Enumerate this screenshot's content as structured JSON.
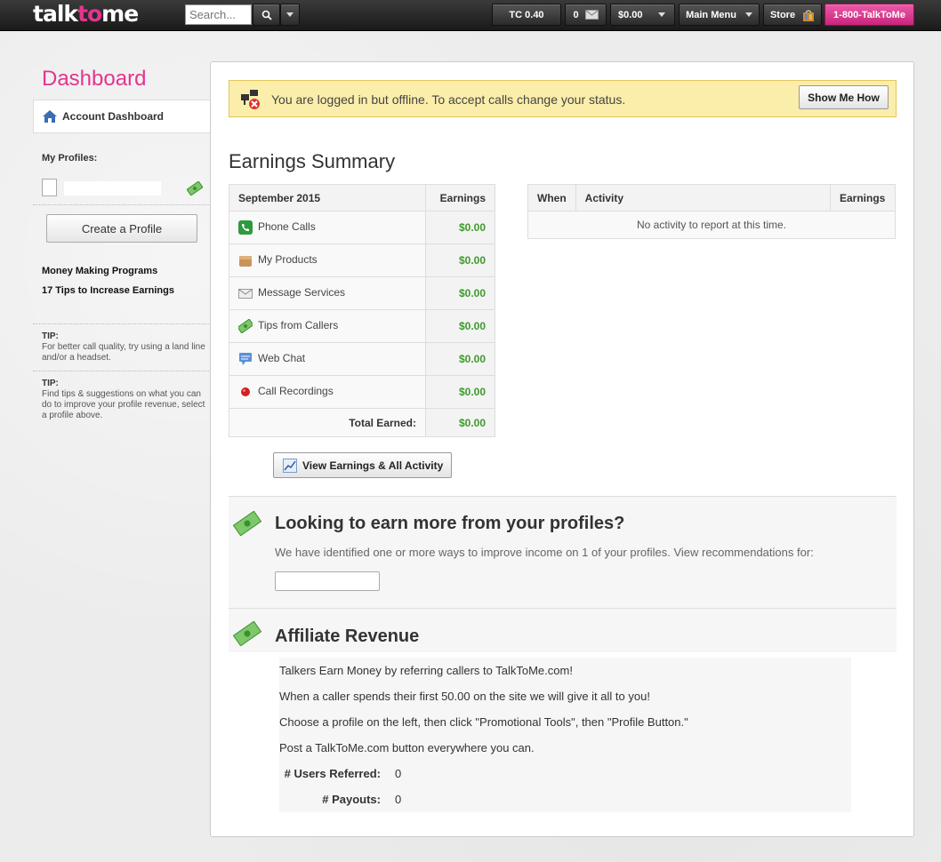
{
  "topbar": {
    "logo_a": "talk",
    "logo_b": "to",
    "logo_c": "me",
    "search_placeholder": "Search...",
    "tc_balance": "TC 0.40",
    "messages_count": "0",
    "balance": "$0.00",
    "main_menu": "Main Menu",
    "store": "Store",
    "phone": "1-800-TalkToMe"
  },
  "sidebar": {
    "title": "Dashboard",
    "account_tab": "Account Dashboard",
    "my_profiles": "My Profiles:",
    "create_profile": "Create a Profile",
    "links": [
      "Money Making Programs",
      "17 Tips to Increase Earnings"
    ],
    "tips": [
      {
        "label": "TIP:",
        "text": "For better call quality, try using a land line and/or a headset."
      },
      {
        "label": "TIP:",
        "text": "Find tips & suggestions on what you can do to improve your profile revenue, select a profile above."
      }
    ]
  },
  "alert": {
    "text": "You are logged in but offline. To accept calls change your status.",
    "button": "Show Me How"
  },
  "earnings": {
    "title": "Earnings Summary",
    "period": "September 2015",
    "col_earnings": "Earnings",
    "rows": [
      {
        "label": "Phone Calls",
        "amount": "$0.00",
        "icon": "phone-icon"
      },
      {
        "label": "My Products",
        "amount": "$0.00",
        "icon": "box-icon"
      },
      {
        "label": "Message Services",
        "amount": "$0.00",
        "icon": "envelope-icon"
      },
      {
        "label": "Tips from Callers",
        "amount": "$0.00",
        "icon": "money-icon"
      },
      {
        "label": "Web Chat",
        "amount": "$0.00",
        "icon": "chat-icon"
      },
      {
        "label": "Call Recordings",
        "amount": "$0.00",
        "icon": "record-icon"
      }
    ],
    "total_label": "Total Earned:",
    "total_amount": "$0.00",
    "view_button": "View Earnings & All Activity"
  },
  "activity": {
    "col_when": "When",
    "col_activity": "Activity",
    "col_earnings": "Earnings",
    "empty": "No activity to report at this time."
  },
  "earn_more": {
    "title": "Looking to earn more from your profiles?",
    "desc": "We have identified one or more ways to improve income on 1 of your profiles. View recommendations for:"
  },
  "affiliate": {
    "title": "Affiliate Revenue",
    "lines": [
      "Talkers Earn Money by referring callers to TalkToMe.com!",
      "When a caller spends their first 50.00 on the site we will give it all to you!",
      "Choose a profile on the left, then click \"Promotional Tools\", then \"Profile Button.\"",
      "Post a TalkToMe.com button everywhere you can."
    ],
    "users_label": "# Users Referred:",
    "users_value": "0",
    "payouts_label": "# Payouts:",
    "payouts_value": "0"
  }
}
